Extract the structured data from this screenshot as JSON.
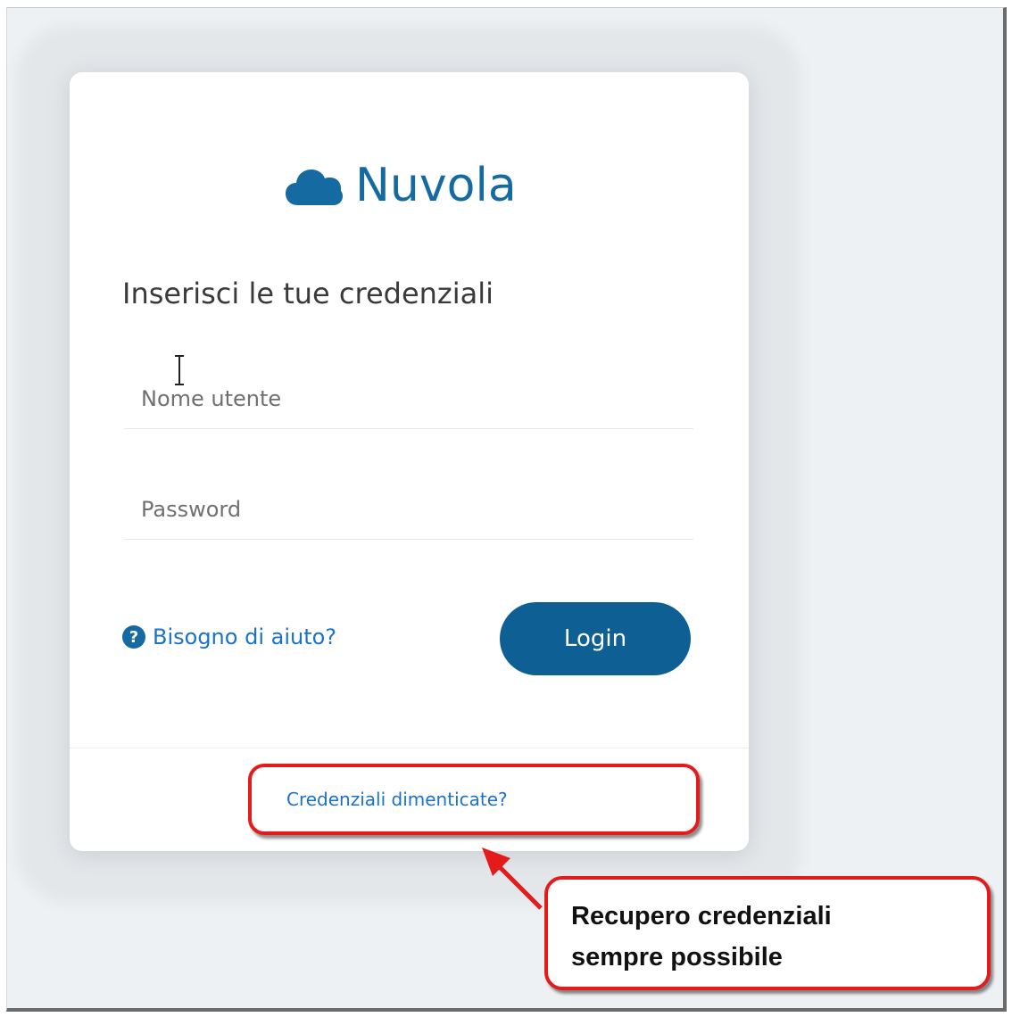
{
  "brand": {
    "name": "Nuvola",
    "icon": "cloud-icon",
    "color": "#156ba1"
  },
  "form": {
    "heading": "Inserisci le tue credenziali",
    "username_placeholder": "Nome utente",
    "password_placeholder": "Password",
    "help_icon": "question-circle-icon",
    "help_label": "Bisogno di aiuto?",
    "login_label": "Login",
    "forgot_label": "Credenziali dimenticate?"
  },
  "annotation": {
    "line1": "Recupero credenziali",
    "line2": "sempre possibile",
    "color": "#e41b1b"
  }
}
